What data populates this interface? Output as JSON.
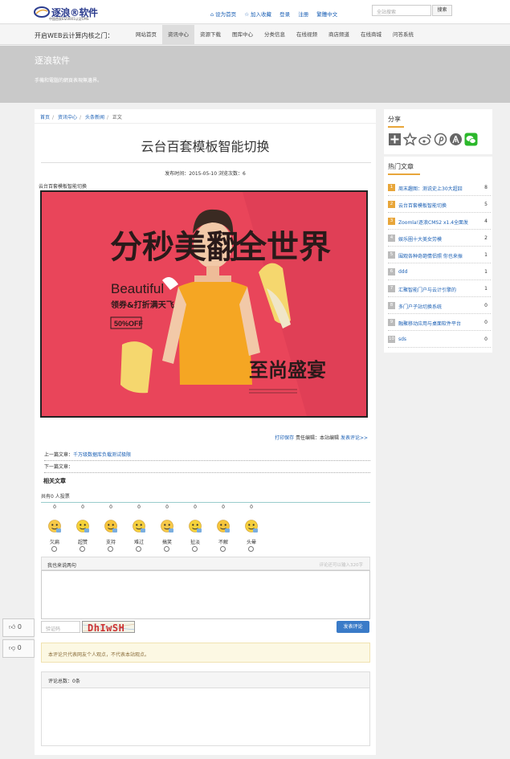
{
  "header": {
    "brand": "逐浪®软件",
    "brand_sub": "中国首家EIZ0001认证CMS",
    "links": [
      {
        "label": "设为首页",
        "icon": "home-icon"
      },
      {
        "label": "加入收藏",
        "icon": "star-icon"
      },
      {
        "label": "登录"
      },
      {
        "label": "注册"
      },
      {
        "label": "繁體中文"
      }
    ],
    "search_placeholder": "全站搜索",
    "search_button": "搜索"
  },
  "nav": {
    "slogan": "开启WEB云计算内核之门：",
    "items": [
      "网站首页",
      "资讯中心",
      "资源下载",
      "图库中心",
      "分类信息",
      "在线视频",
      "商店频道",
      "在线商城",
      "问答系统"
    ],
    "active_index": 1
  },
  "banner": {
    "title": "逐浪软件",
    "subtitle": "手機和電腦的網頁表現無邊界。"
  },
  "breadcrumb": [
    "首页",
    "资讯中心",
    "头条新闻",
    "正文"
  ],
  "article": {
    "title": "云台百套模板智能切换",
    "meta": "发布时间：2015-05-10 浏览次数：6",
    "image_caption": "云台百套模板智能切换",
    "hero_text": {
      "headline_left": "分秒美翻",
      "headline_right": "全世界",
      "beautiful": "Beautiful",
      "promo": "领券&打折满天飞",
      "discount": "50%OFF",
      "sale_title": "至尚盛宴"
    },
    "actions": {
      "print": "打印保存",
      "editor_label": "责任编辑：本站编辑",
      "comment": "发表评论>>"
    },
    "prev_label": "上一篇文章：",
    "prev_link": "千万级数据库负载测试极限",
    "next_label": "下一篇文章：",
    "related": "相关文章"
  },
  "votes": {
    "total": "共有0 人投票",
    "moods": [
      {
        "label": "欠扁",
        "count": "0"
      },
      {
        "label": "超赞",
        "count": "0"
      },
      {
        "label": "支持",
        "count": "0"
      },
      {
        "label": "难过",
        "count": "0"
      },
      {
        "label": "搞笑",
        "count": "0"
      },
      {
        "label": "扯淡",
        "count": "0"
      },
      {
        "label": "不解",
        "count": "0"
      },
      {
        "label": "头晕",
        "count": "0"
      }
    ]
  },
  "comment_form": {
    "head": "我也来说两句",
    "limit_hint": "评论还可以输入320字",
    "captcha_placeholder": "验证码",
    "captcha_text": "DhIwSH",
    "submit": "发表评论"
  },
  "notice": "本评论只代表网友个人观点，不代表本站观点。",
  "comments_total": "评论总数：0条",
  "side_buttons": {
    "like": "0",
    "dislike": "0"
  },
  "sidebar": {
    "share_title": "分享",
    "share_icons": [
      "plus-icon",
      "star-icon",
      "weibo-icon",
      "pinterest-icon",
      "renren-icon",
      "wechat-icon"
    ],
    "hot_title": "热门文章",
    "hot": [
      {
        "n": "1",
        "title": "周末趣图：测说史上30大超囧",
        "count": "8"
      },
      {
        "n": "2",
        "title": "云台百套模板智能切换",
        "count": "5"
      },
      {
        "n": "3",
        "title": "Zoomla!逐浪CMS2 x1.4全面发",
        "count": "4"
      },
      {
        "n": "4",
        "title": "娱乐圈十大美女劳模",
        "count": "2"
      },
      {
        "n": "5",
        "title": "围观各种奇葩情侣照 你也来振",
        "count": "1"
      },
      {
        "n": "6",
        "title": "ddd",
        "count": "1"
      },
      {
        "n": "7",
        "title": "汇聚智能门户与云计引擎的",
        "count": "1"
      },
      {
        "n": "8",
        "title": "多门户子站切换系统",
        "count": "0"
      },
      {
        "n": "9",
        "title": "融聚移动应用与桌面软件平台",
        "count": "0"
      },
      {
        "n": "10",
        "title": "sds",
        "count": "0"
      }
    ]
  },
  "colors": {
    "accent": "#1a5fb4",
    "hot_accent": "#e8a63a",
    "submit": "#3a7bc8",
    "hero_bg": "#e9455a"
  }
}
